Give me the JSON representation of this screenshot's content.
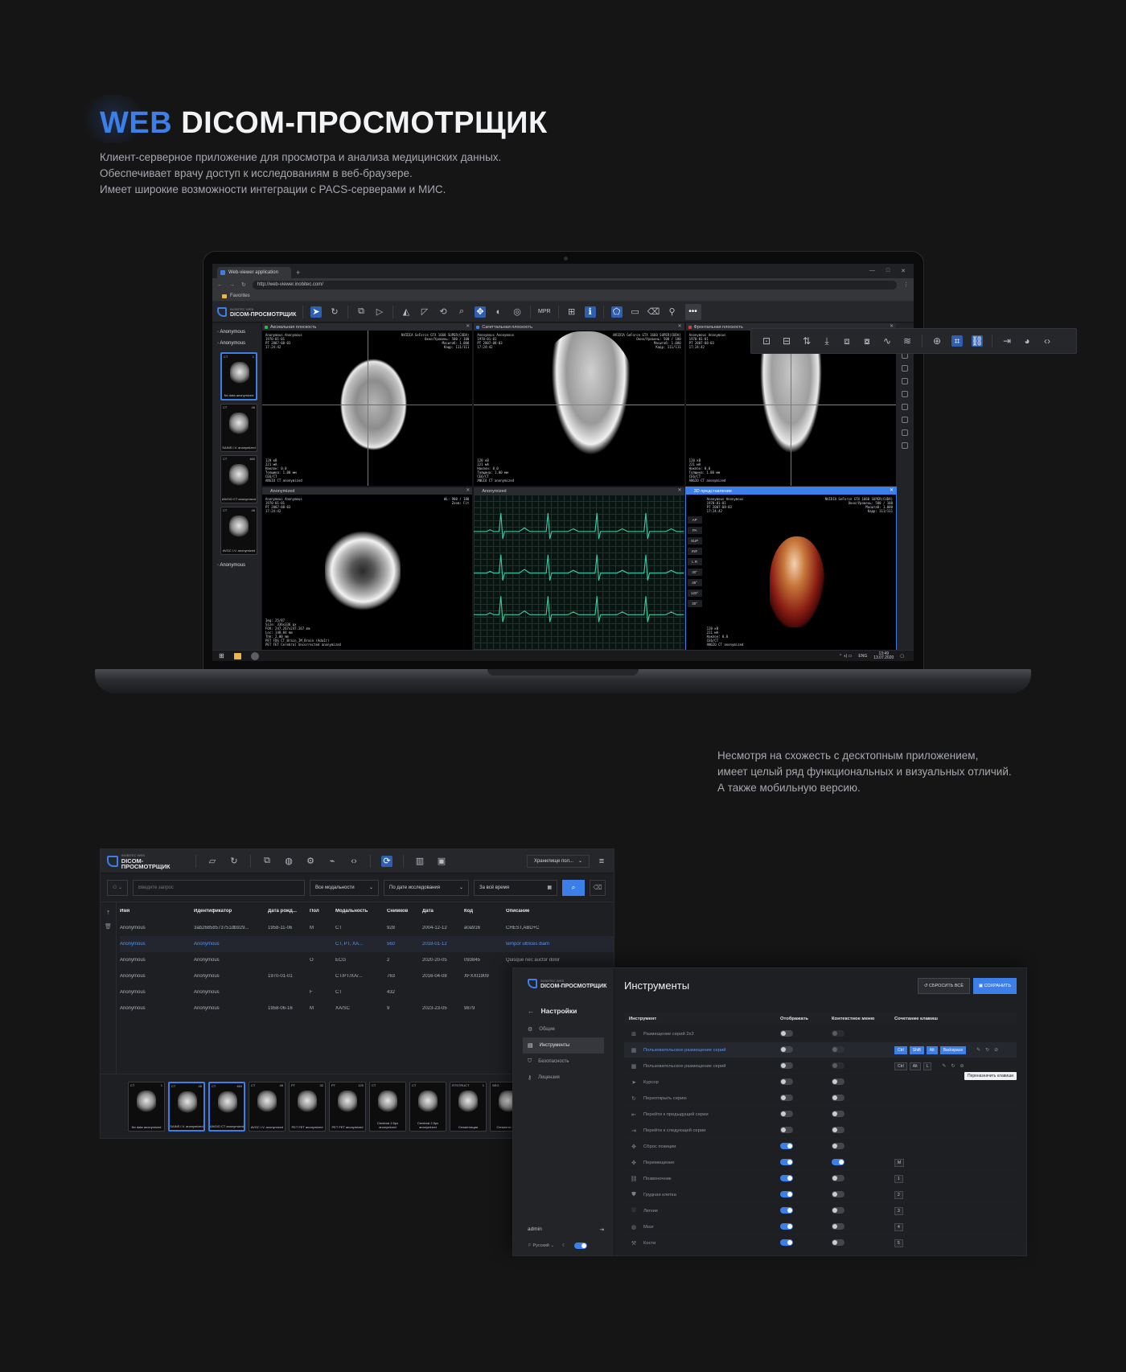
{
  "hero": {
    "title_accent": "WEB",
    "title_rest": "DICOM-ПРОСМОТРЩИК",
    "subtitle_lines": [
      "Клиент-серверное приложение для просмотра и анализа медицинских данных.",
      "Обеспечивает врачу доступ к исследованиям в веб-браузере.",
      "Имеет широкие возможности интеграции с PACS-серверами и МИС."
    ]
  },
  "browser": {
    "tab_title": "Web-viewer application",
    "url": "http://web-viewer.inobitec.com/",
    "favorites": "Favorites"
  },
  "app": {
    "logo_small": "INOBITEC WEB",
    "logo_big": "DICOM-ПРОСМОТРЩИК",
    "mpr_label": "MPR",
    "patients": [
      "Anonymous",
      "Anonymous",
      "Anonymous"
    ],
    "thumbs": [
      {
        "mod": "CT",
        "num": "1",
        "caption": "No data anonymized",
        "selected": true
      },
      {
        "mod": "CT",
        "num": "48",
        "caption": "SAINS I.V. anonymized",
        "selected": false
      },
      {
        "mod": "CT",
        "num": "460",
        "caption": "ANGIO CT anonymized",
        "selected": false
      },
      {
        "mod": "CT",
        "num": "48",
        "caption": "AVGC I.V. anonymized",
        "selected": false
      }
    ],
    "viewports": [
      {
        "title": "Аксиальная плоскость",
        "dot": "#3bb34a",
        "tl": "Anonymous Anonymous\n1970-01-01\nPT 2007-08-03\n17:24:42",
        "tr": "NVIDIA GeForce GTX 1660 SUPER(CUDA)\nОкно/Уровень: 500 / 100\nМасштаб: 1.000\nКадр: 111/111",
        "bl": "120 кВ\n221 мА\nНаклон: 0.0\nТолщина: 1.00 мм\nCE6/CT\nANGIO CT anonymized"
      },
      {
        "title": "Сагиттальная плоскость",
        "dot": "#3d7fe8",
        "tl": "Anonymous Anonymous\n1970-01-01\nPT 2007-08-03\n17:24:42",
        "tr": "NVIDIA GeForce GTX 1660 SUPER(CUDA)\nОкно/Уровень: 500 / 100\nМасштаб: 1.000\nКадр: 111/111",
        "bl": "120 кВ\n221 мА\nНаклон: 0.0\nТолщина: 1.00 мм\nCE6/CT\nANGIO CT anonymized"
      },
      {
        "title": "Фронтальная плоскость",
        "dot": "#d24141",
        "tl": "Anonymous Anonymous\n1970-01-01\nPT 2007-08-03\n17:24:42",
        "tr": "NVIDIA GeForce GTX 1660 SUPER(CUDA)\nОкно/Уровень: 500 / 100\nМасштаб: 1.000\nКадр: 111/111",
        "bl": "120 кВ\n221 мА\nНаклон: 0.0\nТолщина: 1.00 мм\nCE6/CT\nANGIO CT anonymized"
      },
      {
        "title": "Anonymized",
        "dot": "",
        "tl": "Anonymous Anonymous\n1970-01-01\nPT 2007-08-03\n17:24:42",
        "tr": "WL: 900 / 180\nZoom: Fit",
        "bl": "Img: 25/87\nSize: 336x336 px\nFOV: 247.267x247.267 mm\nLoc: 148.84 mm\nThk: 2.00 mm\nPET FDG CT_Brain_IM_Brain (AdaIr)\nPET FET Cerebral Uncorrected anonymized"
      },
      {
        "title": "Anonymized",
        "dot": "",
        "tl": "",
        "tr": "",
        "bl": ""
      },
      {
        "title": "3D представление",
        "dot": "",
        "tl": "Anonymous Anonymous\n1970-01-01\nPT 2007-08-03\n17:24:42",
        "tr": "NVIDIA GeForce GTX 1660 SUPER(CUDA)\nОкно/Уровень: 500 / 100\nМасштаб: 1.000\nКадр: 111/111",
        "bl": "120 кВ\n221 мА\nНаклон: 0.0\nCE6/CT\nANGIO CT anonymized"
      }
    ],
    "vr_buttons": [
      "AP",
      "PA",
      "SUP",
      "INF",
      "L R",
      "30°",
      "45°",
      "120°",
      "30°"
    ],
    "taskbar": {
      "lang": "ENG",
      "time": "13:49",
      "date": "13.07.2020"
    }
  },
  "middle_text": [
    "Несмотря на схожесть с десктопным приложением,",
    "имеет целый ряд функциональных и визуальных отличий.",
    "А также мобильную версию."
  ],
  "study_list": {
    "storage": "Хранилище пол...",
    "search_placeholder": "Введите запрос",
    "filter_modality": "Все модальности",
    "filter_sort": "По дате исследования",
    "filter_period": "За всё время",
    "columns": [
      "Имя",
      "Идентификатор",
      "Дата рожд...",
      "Пол",
      "Модальность",
      "Снимков",
      "Дата",
      "Код",
      "Описание"
    ],
    "rows": [
      [
        "Anonymous",
        "3ab26858573751db929...",
        "1958-11-06",
        "M",
        "CT",
        "928",
        "2004-12-12",
        "a0a916",
        "CHEST,ABD+C"
      ],
      [
        "Anonymous",
        "Anonymous",
        "",
        "",
        "CT, PT, XA...",
        "560",
        "2018-01-12",
        "",
        "tempor ultrices diam"
      ],
      [
        "Anonymous",
        "Anonymous",
        "",
        "O",
        "ECG",
        "2",
        "2020-20-05",
        "093845",
        "Quisque nec auctor dolor"
      ],
      [
        "Anonymous",
        "Anonymous",
        "1970-01-01",
        "",
        "CT/PT/XA/...",
        "763",
        "2016-04-08",
        "XFXXI1909",
        ""
      ],
      [
        "Anonymous",
        "Anonymous",
        "",
        "F",
        "CT",
        "432",
        "",
        "",
        ""
      ],
      [
        "Anonymous",
        "Anonymous",
        "1958-06-16",
        "M",
        "XA/SC",
        "9",
        "2023-23-05",
        "9879",
        ""
      ]
    ],
    "thumbs": [
      {
        "mod": "CT",
        "num": "1",
        "caption": "No data anonymized",
        "selected": false
      },
      {
        "mod": "CT",
        "num": "48",
        "caption": "SAINS I.V. anonymized",
        "selected": true
      },
      {
        "mod": "CT",
        "num": "460",
        "caption": "ANGIO CT anonymized",
        "selected": true
      },
      {
        "mod": "CT",
        "num": "48",
        "caption": "AVGC I.V. anonymized",
        "selected": false
      },
      {
        "mod": "PT",
        "num": "32",
        "caption": "PET FET anonymized",
        "selected": false
      },
      {
        "mod": "PT",
        "num": "120",
        "caption": "PET FET anonymized",
        "selected": false
      },
      {
        "mod": "CT",
        "num": "",
        "caption": "Cerebral 2.5px anonymized",
        "selected": false
      },
      {
        "mod": "CT",
        "num": "",
        "caption": "Cerebral 2.5px anonymized",
        "selected": false
      },
      {
        "mod": "RTSTRUCT",
        "num": "1",
        "caption": "Сегментация",
        "selected": false
      },
      {
        "mod": "SEG",
        "num": "",
        "caption": "Сегменте экспо",
        "selected": false
      }
    ]
  },
  "settings": {
    "back_label": "Настройки",
    "nav": [
      {
        "label": "Общие",
        "active": false
      },
      {
        "label": "Инструменты",
        "active": true
      },
      {
        "label": "Безопасность",
        "active": false
      },
      {
        "label": "Лицензия",
        "active": false
      }
    ],
    "user": "admin",
    "lang": "Русский",
    "title": "Инструменты",
    "reset_label": "СБРОСИТЬ ВСЁ",
    "save_label": "СОХРАНИТЬ",
    "columns": [
      "Инструмент",
      "Отображать",
      "Контекстное меню",
      "Сочетание клавиш"
    ],
    "tooltip": "Переназначить клавиши",
    "tools": [
      {
        "name": "Размещение серий 2x2",
        "show": false,
        "ctx": false,
        "ctx_dim": true,
        "keys": [],
        "highlight": false,
        "actions": false
      },
      {
        "name": "Пользовательское размещение серий",
        "show": false,
        "ctx": false,
        "ctx_dim": true,
        "keys": [
          "Ctrl",
          "Shift",
          "Alt",
          "Backspace"
        ],
        "highlight": true,
        "actions": true
      },
      {
        "name": "Пользовательское размещение серий",
        "show": false,
        "ctx": false,
        "ctx_dim": true,
        "keys": [
          "Ctrl",
          "Alt",
          "L"
        ],
        "highlight": false,
        "actions": true
      },
      {
        "name": "Курсор",
        "show": false,
        "ctx": false,
        "ctx_dim": false,
        "keys": [],
        "highlight": false,
        "actions": false
      },
      {
        "name": "Переоткрыть серию",
        "show": false,
        "ctx": false,
        "ctx_dim": false,
        "keys": [],
        "highlight": false,
        "actions": false
      },
      {
        "name": "Перейти к предыдущей серии",
        "show": false,
        "ctx": false,
        "ctx_dim": false,
        "keys": [],
        "highlight": false,
        "actions": false
      },
      {
        "name": "Перейти к следующей серии",
        "show": false,
        "ctx": false,
        "ctx_dim": false,
        "keys": [],
        "highlight": false,
        "actions": false
      },
      {
        "name": "Сброс позиции",
        "show": true,
        "ctx": false,
        "ctx_dim": false,
        "keys": [],
        "highlight": false,
        "actions": false
      },
      {
        "name": "Перемещение",
        "show": true,
        "ctx": true,
        "ctx_dim": false,
        "keys": [
          "M"
        ],
        "highlight": false,
        "actions": false
      },
      {
        "name": "Позвоночник",
        "show": true,
        "ctx": false,
        "ctx_dim": false,
        "keys": [
          "1"
        ],
        "highlight": false,
        "actions": false
      },
      {
        "name": "Грудная клетка",
        "show": true,
        "ctx": false,
        "ctx_dim": false,
        "keys": [
          "2"
        ],
        "highlight": false,
        "actions": false
      },
      {
        "name": "Легкие",
        "show": true,
        "ctx": false,
        "ctx_dim": false,
        "keys": [
          "3"
        ],
        "highlight": false,
        "actions": false
      },
      {
        "name": "Мозг",
        "show": true,
        "ctx": false,
        "ctx_dim": false,
        "keys": [
          "4"
        ],
        "highlight": false,
        "actions": false
      },
      {
        "name": "Кости",
        "show": true,
        "ctx": false,
        "ctx_dim": false,
        "keys": [
          "5"
        ],
        "highlight": false,
        "actions": false
      }
    ]
  },
  "colors": {
    "accent": "#3d7fe8",
    "background": "#151516",
    "panel": "#1e1f23"
  }
}
